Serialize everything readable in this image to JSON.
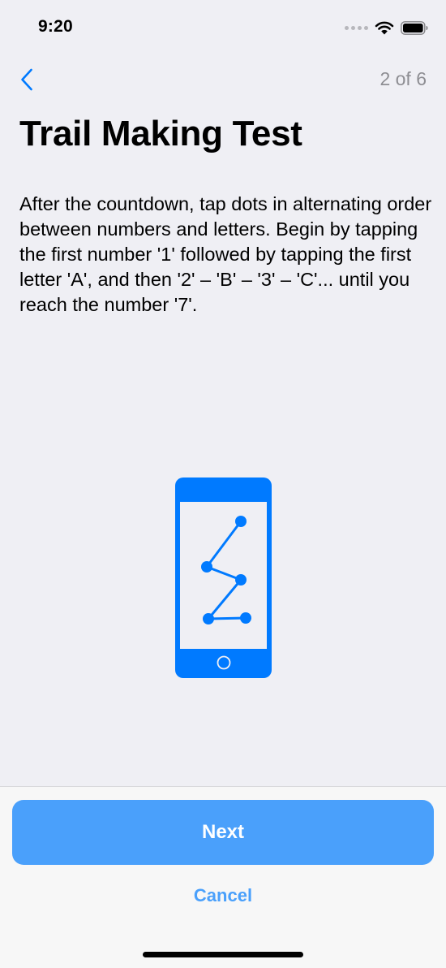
{
  "status_bar": {
    "time": "9:20",
    "icons": [
      "signal-dots-icon",
      "wifi-icon",
      "battery-icon"
    ]
  },
  "nav": {
    "back_icon": "chevron-left-icon",
    "step_counter": "2 of 6"
  },
  "content": {
    "title": "Trail Making Test",
    "instructions": "After the countdown, tap dots in alternating order between numbers and letters. Begin by tapping the first number '1' followed by tapping the first letter 'A', and then '2' – 'B' – '3' – 'C'... until you reach the number '7'.",
    "illustration_icon": "phone-trail-icon"
  },
  "footer": {
    "next_label": "Next",
    "cancel_label": "Cancel"
  },
  "colors": {
    "accent": "#007aff",
    "button_fill": "#4aa0fb",
    "background": "#efeff4",
    "secondary_text": "#8e8e93"
  }
}
